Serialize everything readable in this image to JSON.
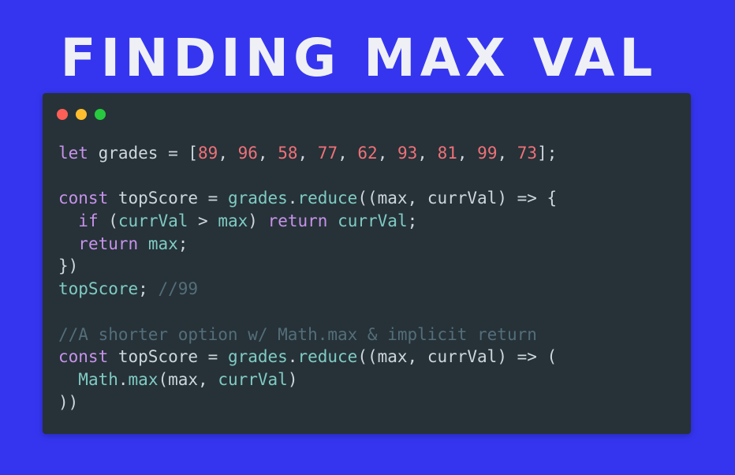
{
  "title": "FINDING MAX VAL",
  "colors": {
    "background": "#3535f0",
    "window": "#263238",
    "dot_close": "#ff5f56",
    "dot_minimize": "#ffbd2e",
    "dot_maximize": "#27c93f",
    "token_keyword": "#c792ea",
    "token_plain": "#cdd6dc",
    "token_number": "#f07178",
    "token_identifier": "#80cbc4",
    "token_comment": "#546e7a"
  },
  "window_controls": [
    "close-dot",
    "minimize-dot",
    "maximize-dot"
  ],
  "code_lines": [
    [
      [
        "let",
        "keyword"
      ],
      [
        " grades = [",
        "plain"
      ],
      [
        "89",
        "number"
      ],
      [
        ", ",
        "plain"
      ],
      [
        "96",
        "number"
      ],
      [
        ", ",
        "plain"
      ],
      [
        "58",
        "number"
      ],
      [
        ", ",
        "plain"
      ],
      [
        "77",
        "number"
      ],
      [
        ", ",
        "plain"
      ],
      [
        "62",
        "number"
      ],
      [
        ", ",
        "plain"
      ],
      [
        "93",
        "number"
      ],
      [
        ", ",
        "plain"
      ],
      [
        "81",
        "number"
      ],
      [
        ", ",
        "plain"
      ],
      [
        "99",
        "number"
      ],
      [
        ", ",
        "plain"
      ],
      [
        "73",
        "number"
      ],
      [
        "];",
        "plain"
      ]
    ],
    [],
    [
      [
        "const",
        "keyword"
      ],
      [
        " topScore = ",
        "plain"
      ],
      [
        "grades",
        "identifier"
      ],
      [
        ".",
        "plain"
      ],
      [
        "reduce",
        "identifier"
      ],
      [
        "((max, currVal) => {",
        "plain"
      ]
    ],
    [
      [
        "  ",
        "plain"
      ],
      [
        "if",
        "keyword"
      ],
      [
        " (",
        "plain"
      ],
      [
        "currVal",
        "identifier"
      ],
      [
        " > ",
        "plain"
      ],
      [
        "max",
        "identifier"
      ],
      [
        ") ",
        "plain"
      ],
      [
        "return",
        "keyword"
      ],
      [
        " ",
        "plain"
      ],
      [
        "currVal",
        "identifier"
      ],
      [
        ";",
        "plain"
      ]
    ],
    [
      [
        "  ",
        "plain"
      ],
      [
        "return",
        "keyword"
      ],
      [
        " ",
        "plain"
      ],
      [
        "max",
        "identifier"
      ],
      [
        ";",
        "plain"
      ]
    ],
    [
      [
        "})",
        "plain"
      ]
    ],
    [
      [
        "topScore",
        "identifier"
      ],
      [
        "; ",
        "plain"
      ],
      [
        "//99",
        "comment"
      ]
    ],
    [],
    [
      [
        "//A shorter option w/ Math.max & implicit return",
        "comment"
      ]
    ],
    [
      [
        "const",
        "keyword"
      ],
      [
        " topScore = ",
        "plain"
      ],
      [
        "grades",
        "identifier"
      ],
      [
        ".",
        "plain"
      ],
      [
        "reduce",
        "identifier"
      ],
      [
        "((max, currVal) => (",
        "plain"
      ]
    ],
    [
      [
        "  ",
        "plain"
      ],
      [
        "Math",
        "identifier"
      ],
      [
        ".",
        "plain"
      ],
      [
        "max",
        "identifier"
      ],
      [
        "(max, ",
        "plain"
      ],
      [
        "currVal",
        "identifier"
      ],
      [
        ")",
        "plain"
      ]
    ],
    [
      [
        "))",
        "plain"
      ]
    ]
  ]
}
